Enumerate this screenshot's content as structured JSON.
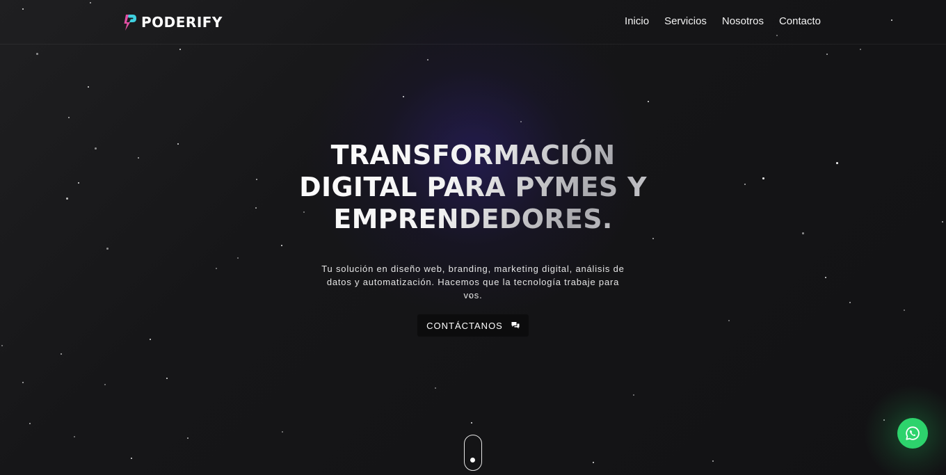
{
  "brand": {
    "name": "PODERIFY",
    "accent_colors": [
      "#3fd1e0",
      "#e24fa3"
    ]
  },
  "nav": {
    "items": [
      {
        "label": "Inicio"
      },
      {
        "label": "Servicios"
      },
      {
        "label": "Nosotros"
      },
      {
        "label": "Contacto"
      }
    ]
  },
  "hero": {
    "title": "TRANSFORMACIÓN DIGITAL PARA PYMES Y EMPRENDEDORES.",
    "subtitle": "Tu solución en diseño web, branding, marketing digital, análisis de datos y automatización. Hacemos que la tecnología trabaje para vos.",
    "cta_label": "CONTÁCTANOS",
    "cta_icon": "chat-bubbles-icon"
  },
  "scroll_indicator": {
    "icon": "mouse-scroll-icon"
  },
  "whatsapp": {
    "icon": "whatsapp-icon",
    "color": "#2dd36c"
  },
  "theme": {
    "background": "#131315",
    "glow": "#2e2078"
  }
}
